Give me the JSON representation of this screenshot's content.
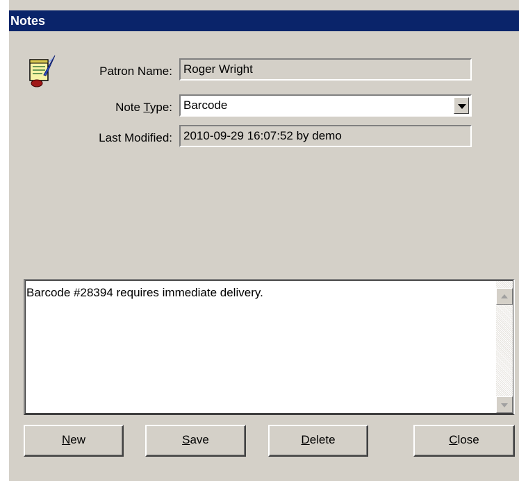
{
  "window": {
    "title": "Notes"
  },
  "form": {
    "patron_name_label": "Patron Name:",
    "patron_name_value": "Roger Wright",
    "note_type_label_pre": "Note ",
    "note_type_label_accel": "T",
    "note_type_label_post": "ype:",
    "note_type_value": "Barcode",
    "last_modified_label": "Last Modified:",
    "last_modified_value": "2010-09-29 16:07:52 by demo"
  },
  "memo": {
    "text": "Barcode #28394 requires immediate delivery."
  },
  "buttons": {
    "new": {
      "accel": "N",
      "rest": "ew"
    },
    "save": {
      "accel": "S",
      "rest": "ave"
    },
    "delete": {
      "accel": "D",
      "rest": "elete"
    },
    "close": {
      "accel": "C",
      "rest": "lose"
    }
  },
  "icons": {
    "app": "notepad-quill-icon",
    "dropdown": "chevron-down-icon"
  },
  "colors": {
    "titlebar": "#0a246a",
    "face": "#d4d0c8"
  }
}
